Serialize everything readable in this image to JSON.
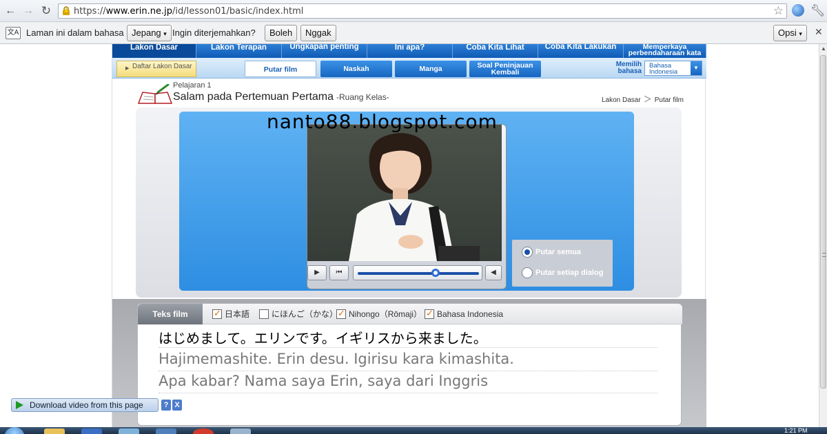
{
  "browser": {
    "url_scheme": "https://",
    "url_domain": "www.erin.ne.jp",
    "url_path": "/id/lesson01/basic/index.html"
  },
  "translate_bar": {
    "message": "Laman ini dalam bahasa",
    "language": "Jepang",
    "question": "Ingin diterjemahkan?",
    "yes_label": "Boleh",
    "no_label": "Nggak",
    "options_label": "Opsi"
  },
  "site": {
    "top_nav": [
      {
        "label": "Lakon Dasar"
      },
      {
        "label": "Lakon Terapan"
      },
      {
        "label": "Ungkapan penting"
      },
      {
        "label": "Ini apa?"
      },
      {
        "label": "Coba Kita Lihat"
      },
      {
        "label": "Coba Kita Lakukan"
      },
      {
        "label": "Memperkaya perbendaharaan kata"
      }
    ],
    "daftar_label": "Daftar Lakon Dasar",
    "sub_tabs": [
      {
        "label": "Putar film"
      },
      {
        "label": "Naskah"
      },
      {
        "label": "Manga"
      },
      {
        "label": "Soal Peninjauan Kembali"
      }
    ],
    "language_label": "Memilih bahasa",
    "language_value": "Bahasa Indonesia",
    "lesson_number": "Pelajaran 1",
    "lesson_title": "Salam pada Pertemuan Pertama",
    "lesson_subtitle": "-Ruang Kelas-",
    "breadcrumb": [
      "Lakon Dasar",
      "Putar film"
    ],
    "watermark": "nanto88.blogspot.com",
    "player": {
      "progress": 0.65
    },
    "play_options": [
      {
        "label": "Putar semua",
        "selected": true
      },
      {
        "label": "Putar setiap dialog",
        "selected": false
      }
    ],
    "text_panel": {
      "tab_label": "Teks film",
      "checkboxes": [
        {
          "label": "日本語",
          "checked": true
        },
        {
          "label": "にほんご（かな）",
          "checked": false
        },
        {
          "label": "Nihongo（Rōmaji）",
          "checked": true
        },
        {
          "label": "Bahasa Indonesia",
          "checked": true
        }
      ],
      "lines": {
        "japanese": "はじめまして。エリンです。イギリスから来ました。",
        "romaji": "Hajimemashite. Erin desu. Igirisu kara kimashita.",
        "indonesian": "Apa kabar? Nama saya Erin, saya dari Inggris"
      }
    }
  },
  "download_bar": {
    "label": "Download video from this page",
    "help": "?",
    "close": "X"
  },
  "taskbar": {
    "clock": "1:21 PM"
  },
  "colors": {
    "nav_blue": "#0f5bb5",
    "stage_blue": "#2e8ee2",
    "check_orange": "#e36b00"
  }
}
